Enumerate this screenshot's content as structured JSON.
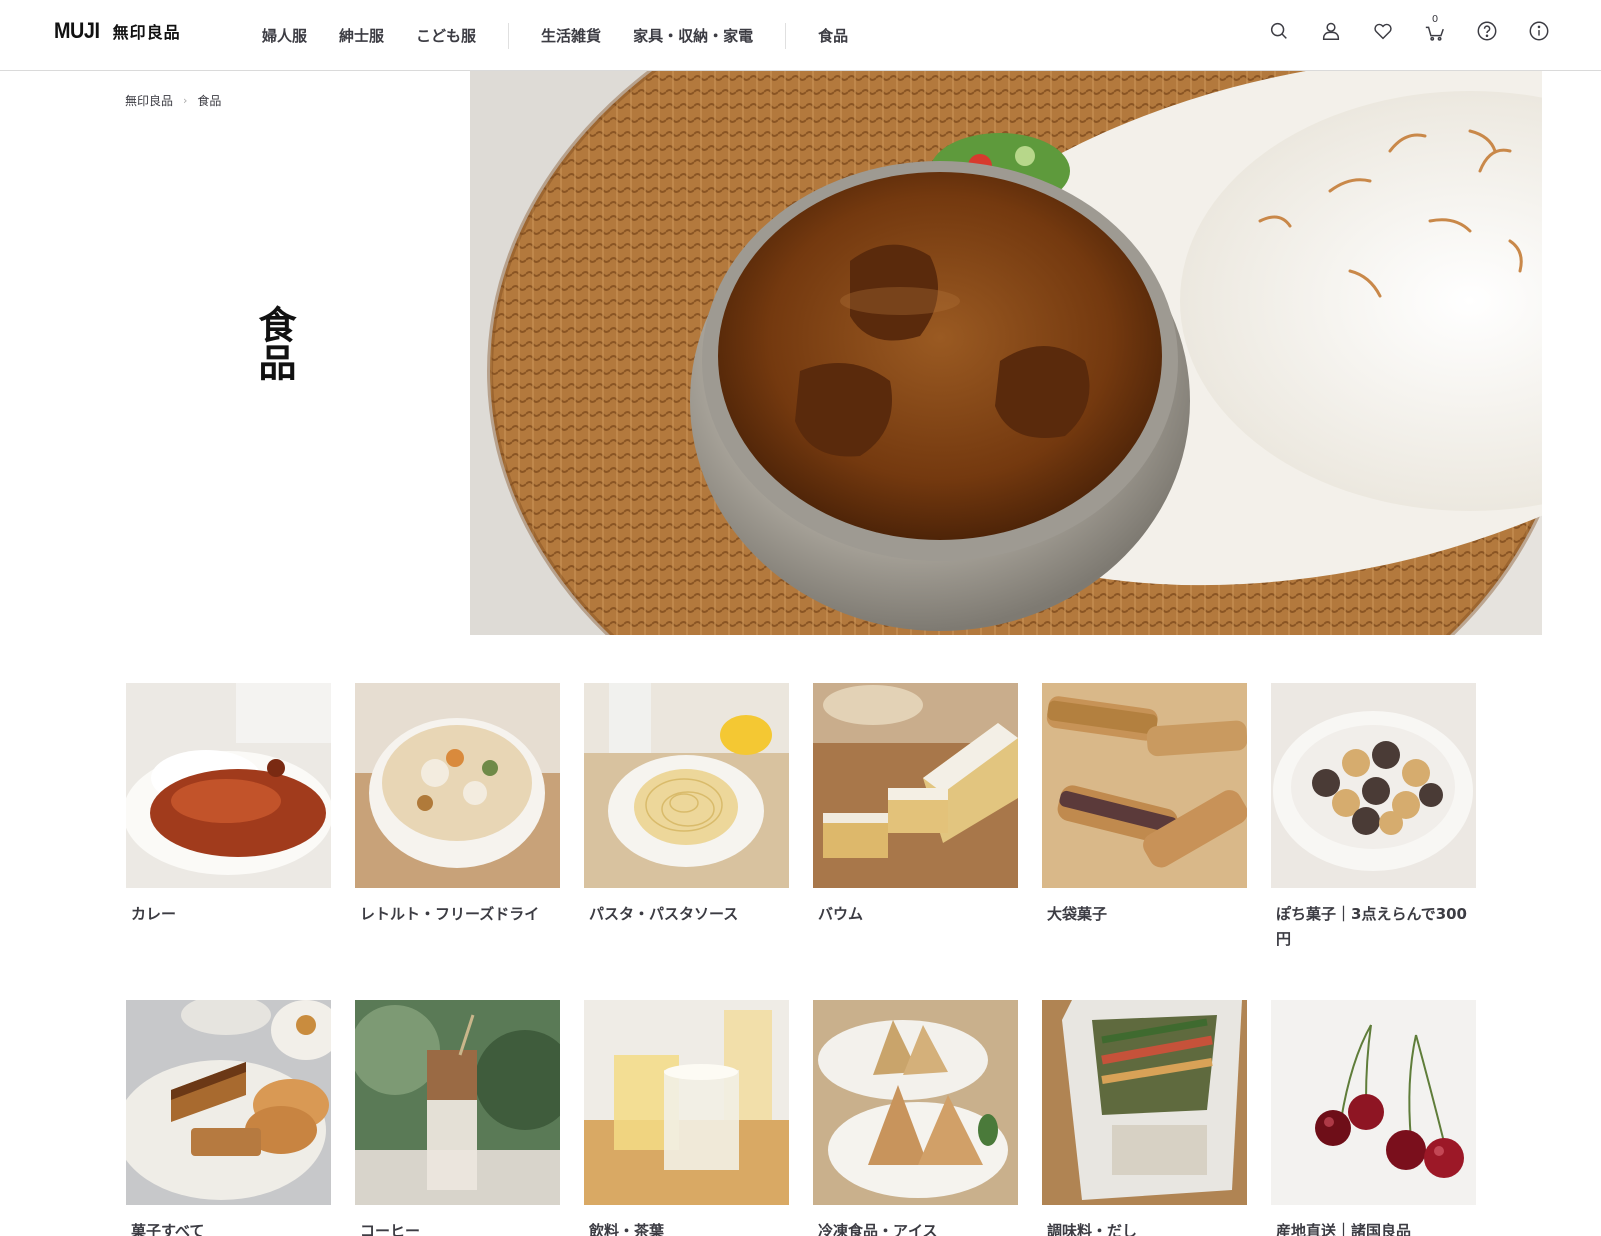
{
  "header": {
    "logo_text": "MUJI",
    "logo_jp": "無印良品",
    "nav": [
      "婦人服",
      "紳士服",
      "こども服",
      "生活雑貨",
      "家具・収納・家電",
      "食品"
    ],
    "cart_count": "0"
  },
  "icons": [
    "search-icon",
    "account-icon",
    "favorite-heart-icon",
    "cart-icon",
    "help-icon",
    "info-icon"
  ],
  "breadcrumb": [
    "無印良品",
    "食品"
  ],
  "page_title": "食品",
  "hero": {
    "alt": "",
    "colors": {
      "curry": "#6b3512",
      "mat": "#b98145",
      "plate": "#f2efe9",
      "rice": "#fbfaf6"
    }
  },
  "categories": [
    {
      "label": "カレー",
      "image": "curry-dish"
    },
    {
      "label": "レトルト・フリーズドライ",
      "image": "stew-bowl"
    },
    {
      "label": "パスタ・パスタソース",
      "image": "pasta-plate"
    },
    {
      "label": "バウム",
      "image": "baum-cake"
    },
    {
      "label": "大袋菓子",
      "image": "pastry-sticks"
    },
    {
      "label": "ぽち菓子｜3点えらんで300円",
      "image": "bear-cookies"
    },
    {
      "label": "菓子すべて",
      "image": "sweets-plate"
    },
    {
      "label": "コーヒー",
      "image": "iced-latte"
    },
    {
      "label": "飲料・茶葉",
      "image": "tea-glasses"
    },
    {
      "label": "冷凍食品・アイス",
      "image": "rice-balls"
    },
    {
      "label": "調味料・だし",
      "image": "stir-fry-bag"
    },
    {
      "label": "産地直送｜諸国良品",
      "image": "cherries"
    }
  ]
}
